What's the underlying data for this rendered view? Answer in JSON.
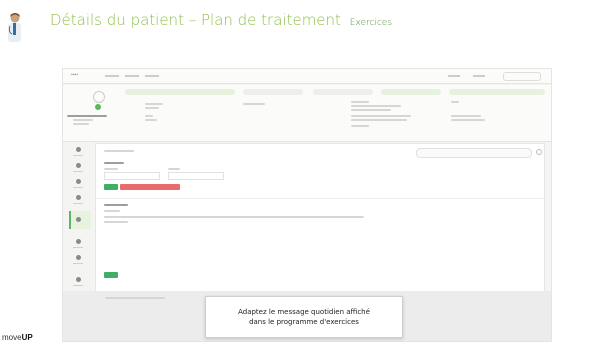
{
  "slide": {
    "title": "Détails du patient – Plan de traitement",
    "subtitle": "Exercices"
  },
  "callout": {
    "line1": "Adaptez le message quotidien affiché",
    "line2": "dans le programme d'exercices"
  },
  "brand": {
    "part1": "move",
    "part2": "UP"
  },
  "colors": {
    "title_green": "#8fc04a",
    "action_green": "#3fae66",
    "danger_red": "#e86a6a"
  }
}
